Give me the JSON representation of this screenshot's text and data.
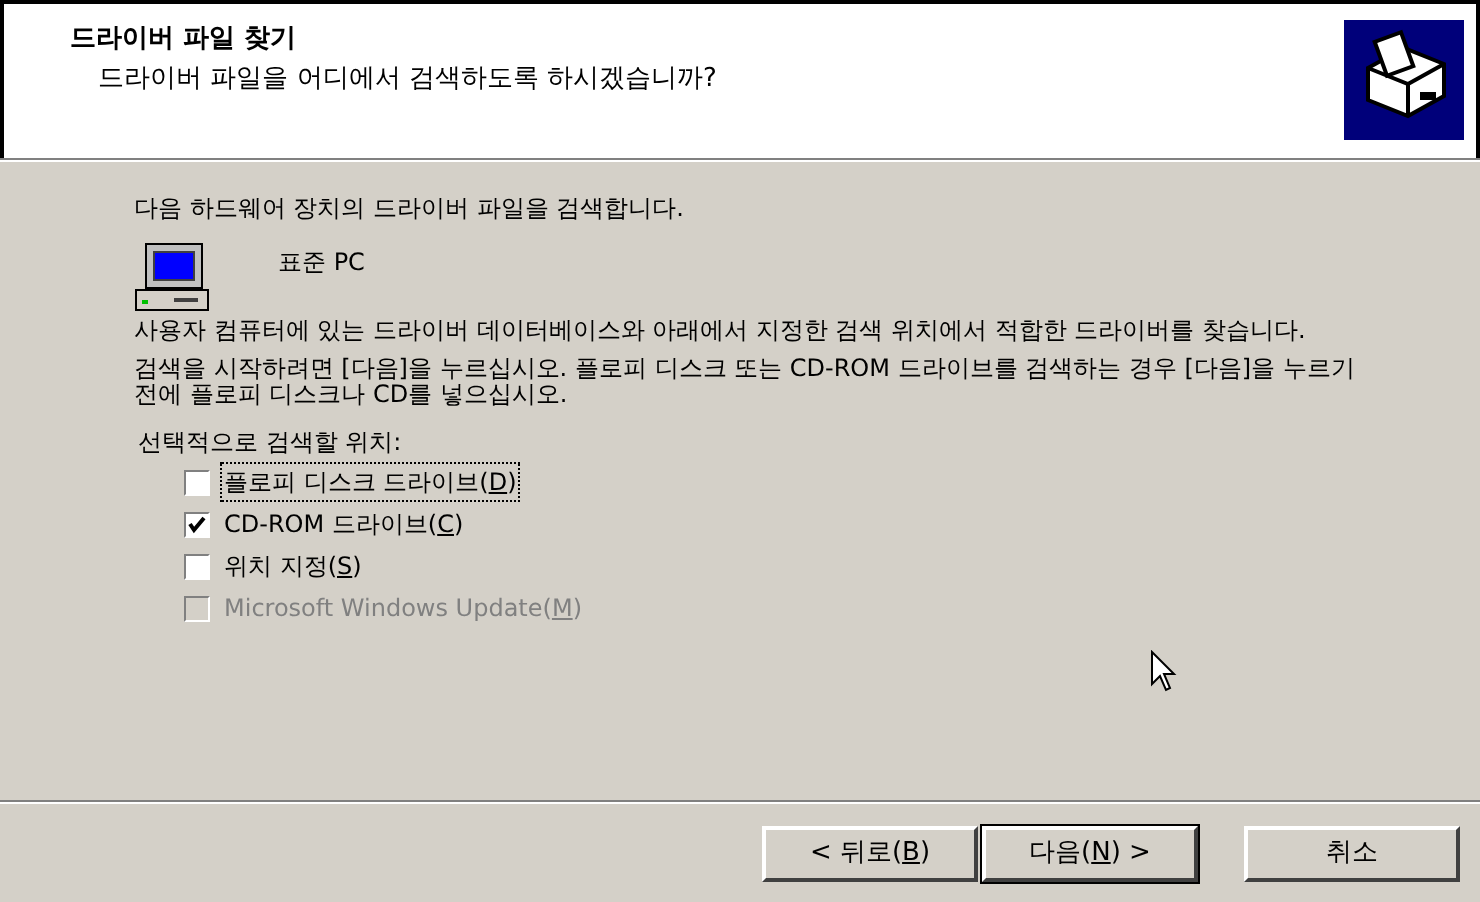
{
  "header": {
    "title": "드라이버 파일 찾기",
    "subtitle": "드라이버 파일을 어디에서 검색하도록 하시겠습니까?"
  },
  "intro": "다음 하드웨어 장치의 드라이버 파일을 검색합니다.",
  "device": {
    "name": "표준 PC"
  },
  "paragraphs": [
    "사용자 컴퓨터에 있는 드라이버 데이터베이스와 아래에서 지정한 검색 위치에서 적합한 드라이버를 찾습니다.",
    "검색을 시작하려면 [다음]을 누르십시오. 플로피 디스크 또는 CD-ROM 드라이브를 검색하는 경우 [다음]을 누르기 전에 플로피 디스크나 CD를 넣으십시오."
  ],
  "options_label": "선택적으로 검색할 위치:",
  "options": [
    {
      "before": "플로피 디스크 드라이브(",
      "key": "D",
      "after": ")",
      "checked": false,
      "disabled": false,
      "focused": true
    },
    {
      "before": "CD-ROM 드라이브(",
      "key": "C",
      "after": ")",
      "checked": true,
      "disabled": false,
      "focused": false
    },
    {
      "before": "위치 지정(",
      "key": "S",
      "after": ")",
      "checked": false,
      "disabled": false,
      "focused": false
    },
    {
      "before": "Microsoft Windows Update(",
      "key": "M",
      "after": ")",
      "checked": false,
      "disabled": true,
      "focused": false
    }
  ],
  "buttons": [
    {
      "before": "< 뒤로(",
      "key": "B",
      "after": ")",
      "default": false
    },
    {
      "before": "다음(",
      "key": "N",
      "after": ") >",
      "default": true
    },
    {
      "label": "취소",
      "default": false
    }
  ]
}
